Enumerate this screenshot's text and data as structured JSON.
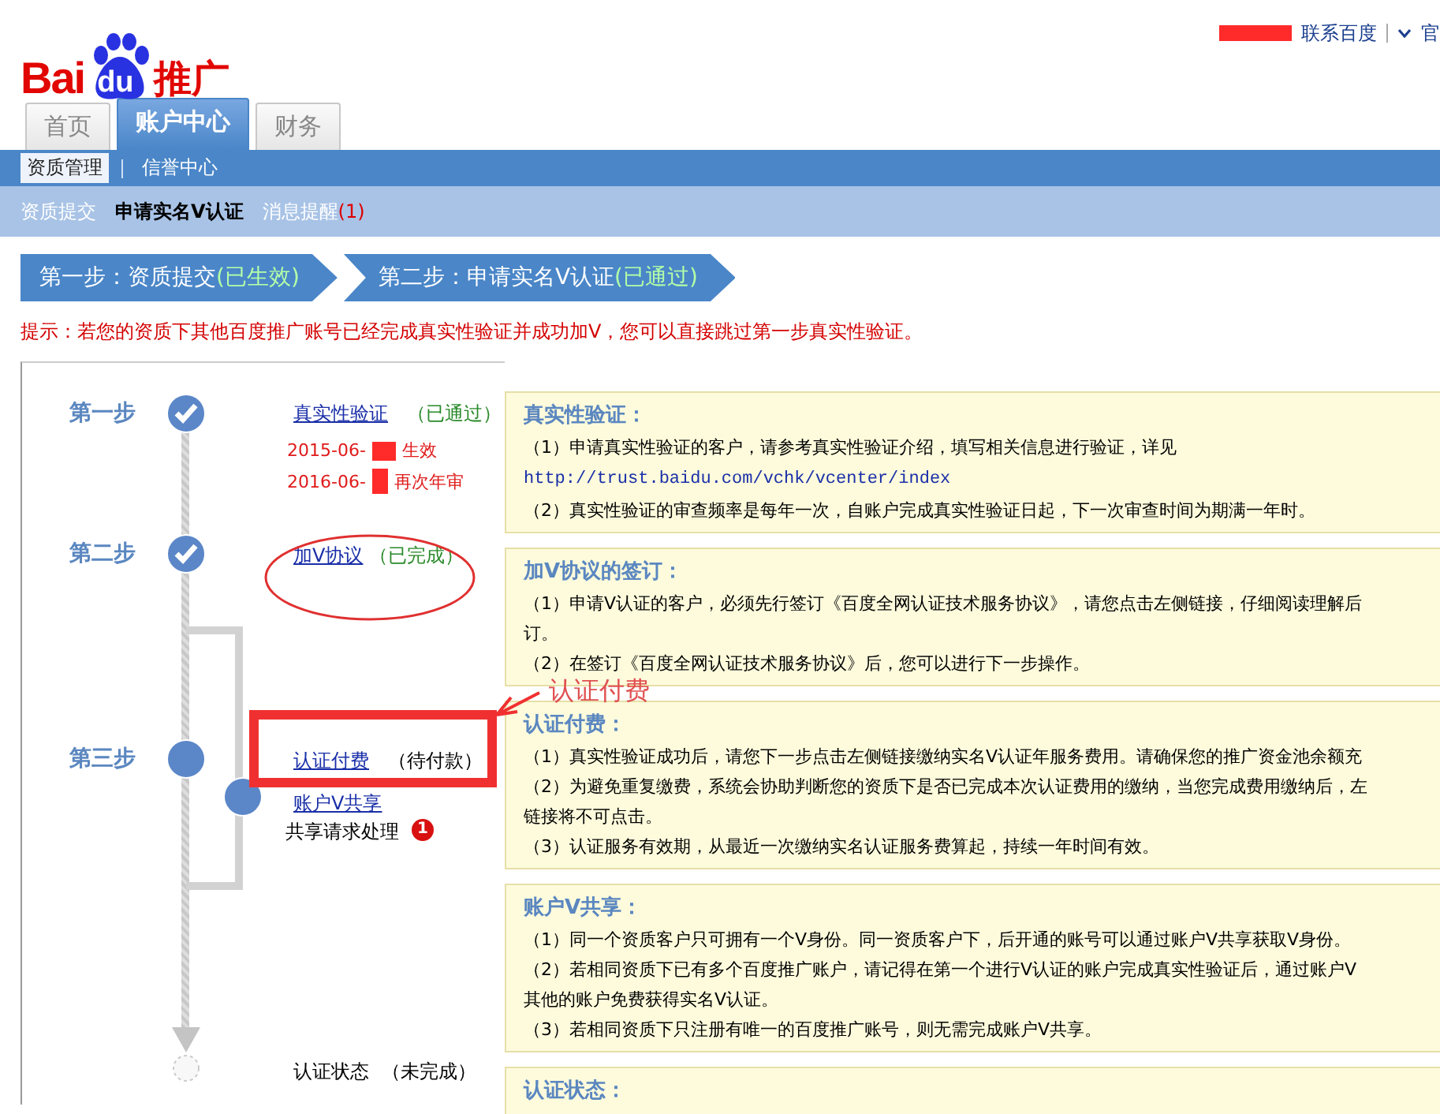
{
  "logo": {
    "brand": "Bai",
    "paw": "du",
    "suffix": "推广"
  },
  "top_links": {
    "contact": "联系百度",
    "official": "官"
  },
  "tabs": [
    {
      "label": "首页",
      "selected": false
    },
    {
      "label": "账户中心",
      "selected": true
    },
    {
      "label": "财务",
      "selected": false
    }
  ],
  "subnav": [
    {
      "label": "资质管理",
      "selected": true
    },
    {
      "label": "信誉中心",
      "selected": false
    }
  ],
  "subsubnav": [
    {
      "label": "资质提交",
      "selected": false
    },
    {
      "label": "申请实名V认证",
      "selected": true
    },
    {
      "label": "消息提醒",
      "count": "(1)",
      "selected": false
    }
  ],
  "progress_steps": [
    {
      "label": "第一步：资质提交",
      "status": "(已生效)"
    },
    {
      "label": "第二步：申请实名V认证",
      "status": "(已通过)"
    }
  ],
  "tip": "提示：若您的资质下其他百度推广账号已经完成真实性验证并成功加V，您可以直接跳过第一步真实性验证。",
  "timeline": {
    "steps": [
      {
        "label": "第一步",
        "done": true
      },
      {
        "label": "第二步",
        "done": true
      },
      {
        "label": "第三步",
        "done": false
      }
    ],
    "verify": {
      "link": "真实性验证",
      "status": "（已通过）",
      "dates": [
        {
          "date": "2015-06-",
          "note": "生效"
        },
        {
          "date": "2016-06-",
          "note": "再次年审"
        }
      ]
    },
    "agreement": {
      "link": "加V协议",
      "status": "（已完成）"
    },
    "payment": {
      "link": "认证付费",
      "status": "（待付款）"
    },
    "share": {
      "link": "账户V共享",
      "request": "共享请求处理",
      "badge": "1"
    },
    "final": {
      "label": "认证状态",
      "status": "（未完成）",
      "done": false
    },
    "annotation": "认证付费"
  },
  "panels": [
    {
      "title": "真实性验证：",
      "lines": [
        {
          "kind": "text",
          "text": "（1）申请真实性验证的客户，请参考真实性验证介绍，填写相关信息进行验证，详见"
        },
        {
          "kind": "link",
          "text": "http://trust.baidu.com/vchk/vcenter/index"
        },
        {
          "kind": "text",
          "text": "（2）真实性验证的审查频率是每年一次，自账户完成真实性验证日起，下一次审查时间为期满一年时。"
        }
      ]
    },
    {
      "title": "加V协议的签订：",
      "lines": [
        {
          "kind": "text",
          "text": "（1）申请V认证的客户，必须先行签订《百度全网认证技术服务协议》，请您点击左侧链接，仔细阅读理解后"
        },
        {
          "kind": "text",
          "text": "订。"
        },
        {
          "kind": "text",
          "text": "（2）在签订《百度全网认证技术服务协议》后，您可以进行下一步操作。"
        }
      ]
    },
    {
      "title": "认证付费：",
      "lines": [
        {
          "kind": "text",
          "text": "（1）真实性验证成功后，请您下一步点击左侧链接缴纳实名V认证年服务费用。请确保您的推广资金池余额充"
        },
        {
          "kind": "text",
          "text": "（2）为避免重复缴费，系统会协助判断您的资质下是否已完成本次认证费用的缴纳，当您完成费用缴纳后，左"
        },
        {
          "kind": "text",
          "text": "链接将不可点击。"
        },
        {
          "kind": "text",
          "text": "（3）认证服务有效期，从最近一次缴纳实名认证服务费算起，持续一年时间有效。"
        }
      ]
    },
    {
      "title": "账户V共享：",
      "lines": [
        {
          "kind": "text",
          "text": "（1）同一个资质客户只可拥有一个V身份。同一资质客户下，后开通的账号可以通过账户V共享获取V身份。"
        },
        {
          "kind": "text",
          "text": "（2）若相同资质下已有多个百度推广账户，请记得在第一个进行V认证的账户完成真实性验证后，通过账户V"
        },
        {
          "kind": "text",
          "text": "其他的账户免费获得实名V认证。"
        },
        {
          "kind": "text",
          "text": "（3）若相同资质下只注册有唯一的百度推广账号，则无需完成账户V共享。"
        }
      ]
    },
    {
      "title": "认证状态："
    }
  ]
}
